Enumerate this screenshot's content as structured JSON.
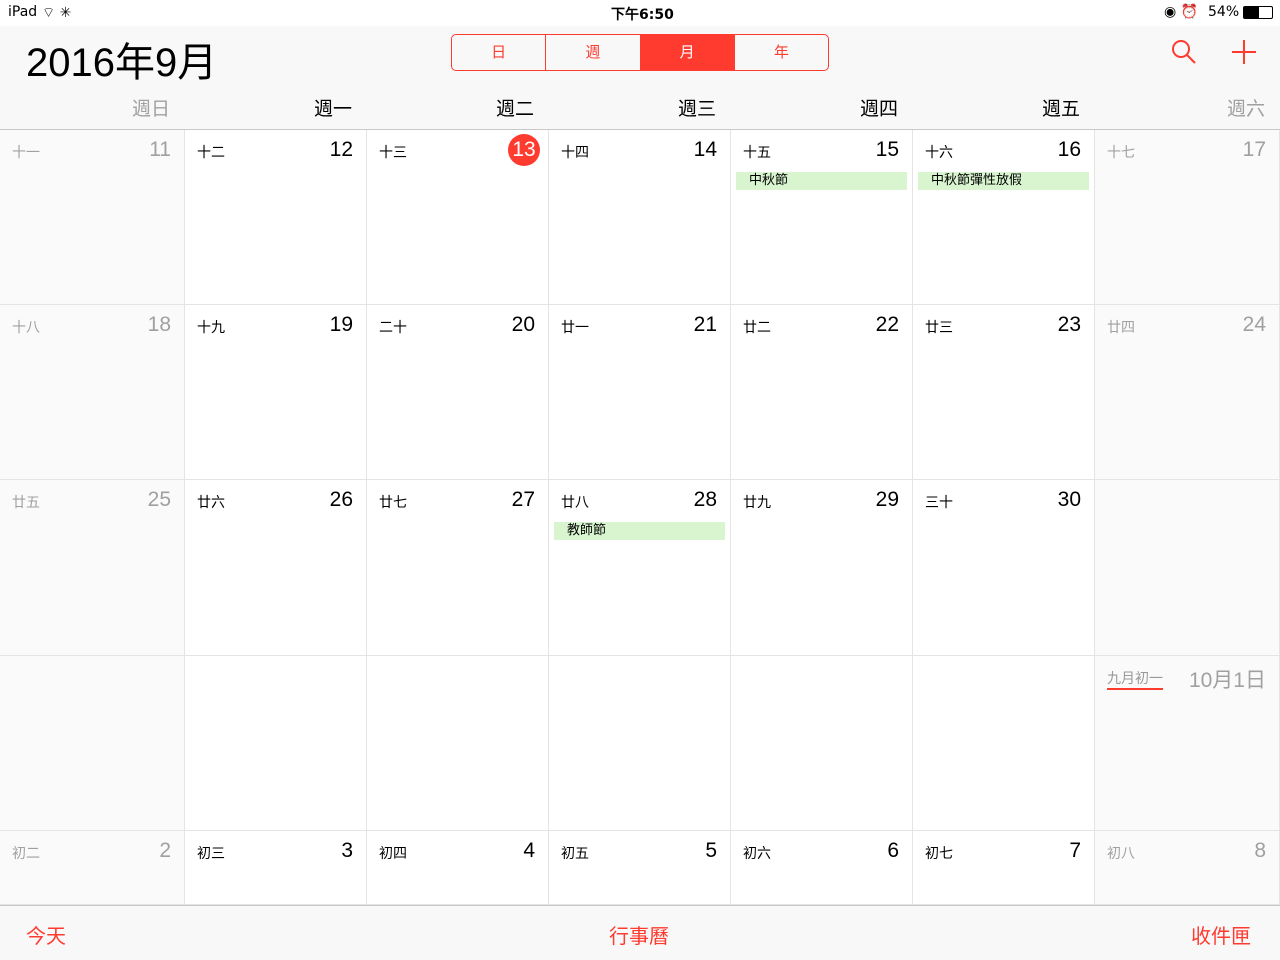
{
  "status": {
    "device": "iPad",
    "time": "下午6:50",
    "battery": "54%"
  },
  "header": {
    "title": "2016年9月",
    "segments": [
      "日",
      "週",
      "月",
      "年"
    ],
    "selected": 2
  },
  "weekdays": [
    "週日",
    "週一",
    "週二",
    "週三",
    "週四",
    "週五",
    "週六"
  ],
  "weeks": [
    [
      {
        "l": "十一",
        "d": "11"
      },
      {
        "l": "十二",
        "d": "12"
      },
      {
        "l": "十三",
        "d": "13",
        "today": true
      },
      {
        "l": "十四",
        "d": "14"
      },
      {
        "l": "十五",
        "d": "15",
        "ev": "中秋節"
      },
      {
        "l": "十六",
        "d": "16",
        "ev": "中秋節彈性放假"
      },
      {
        "l": "十七",
        "d": "17"
      }
    ],
    [
      {
        "l": "十八",
        "d": "18"
      },
      {
        "l": "十九",
        "d": "19"
      },
      {
        "l": "二十",
        "d": "20"
      },
      {
        "l": "廿一",
        "d": "21"
      },
      {
        "l": "廿二",
        "d": "22"
      },
      {
        "l": "廿三",
        "d": "23"
      },
      {
        "l": "廿四",
        "d": "24"
      }
    ],
    [
      {
        "l": "廿五",
        "d": "25"
      },
      {
        "l": "廿六",
        "d": "26"
      },
      {
        "l": "廿七",
        "d": "27"
      },
      {
        "l": "廿八",
        "d": "28",
        "ev": "教師節"
      },
      {
        "l": "廿九",
        "d": "29"
      },
      {
        "l": "三十",
        "d": "30"
      },
      {}
    ],
    [
      {},
      {},
      {},
      {},
      {},
      {},
      {
        "l": "九月初一",
        "d": "10月1日",
        "month": true
      }
    ],
    [
      {
        "l": "初二",
        "d": "2"
      },
      {
        "l": "初三",
        "d": "3"
      },
      {
        "l": "初四",
        "d": "4"
      },
      {
        "l": "初五",
        "d": "5"
      },
      {
        "l": "初六",
        "d": "6"
      },
      {
        "l": "初七",
        "d": "7"
      },
      {
        "l": "初八",
        "d": "8"
      }
    ]
  ],
  "footer": {
    "today": "今天",
    "calendars": "行事曆",
    "inbox": "收件匣"
  }
}
